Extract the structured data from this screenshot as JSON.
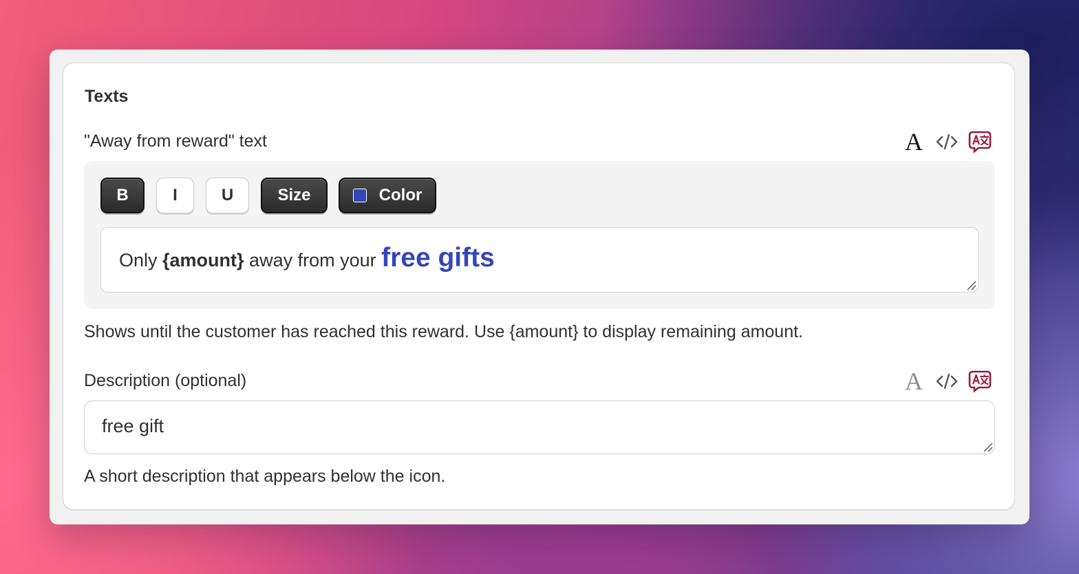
{
  "section": {
    "title": "Texts"
  },
  "away_field": {
    "label": "\"Away from reward\" text",
    "toolbar": {
      "bold": "B",
      "italic": "I",
      "underline": "U",
      "size": "Size",
      "color": "Color",
      "color_value": "#3546b8"
    },
    "content": {
      "part1": "Only ",
      "bold_part": "{amount}",
      "part2": " away from your ",
      "highlight": "free gifts",
      "highlight_color": "#3546b8"
    },
    "help": "Shows until the customer has reached this reward. Use {amount} to display remaining amount."
  },
  "description_field": {
    "label": "Description (optional)",
    "value": "free gift",
    "help": "A short description that appears below the icon."
  },
  "field_icons": [
    "typography-icon",
    "code-icon",
    "translate-icon"
  ],
  "colors": {
    "translate_icon": "#9b1b3a",
    "text": "#303030"
  }
}
